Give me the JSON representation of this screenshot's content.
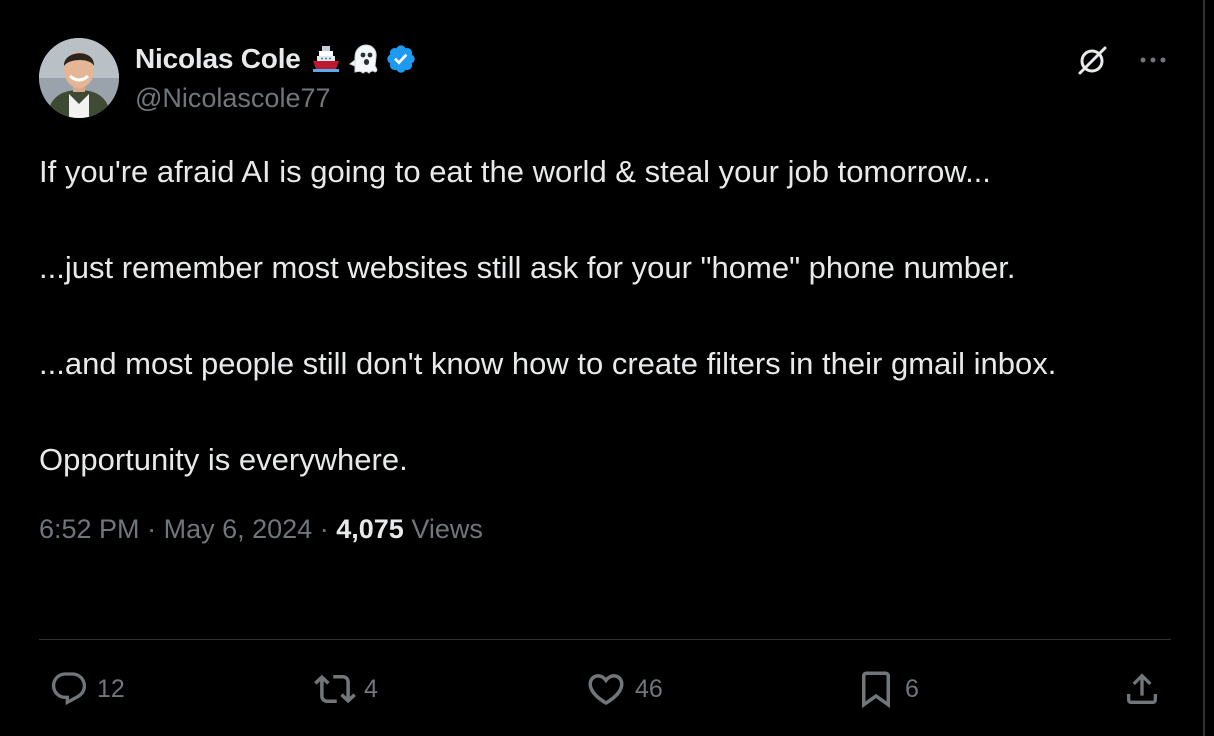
{
  "author": {
    "display_name": "Nicolas Cole",
    "handle": "@Nicolascole77",
    "emojis": [
      "ship-emoji",
      "ghost-emoji"
    ],
    "verified_icon": "verified-badge-icon",
    "verified_color": "#1d9bf0"
  },
  "tweet": {
    "paragraphs": [
      "If you're afraid AI is going to eat the world & steal your job tomorrow...",
      "...just remember most websites still ask for your \"home\" phone number.",
      "...and most people still don't know how to create filters in their gmail inbox.",
      "Opportunity is everywhere."
    ],
    "time": "6:52 PM",
    "date": "May 6, 2024",
    "separator": "·",
    "views_count": "4,075",
    "views_label": "Views"
  },
  "top_actions": {
    "grok_icon": "grok-icon",
    "more_icon": "more-icon"
  },
  "actions": {
    "reply": {
      "icon": "reply-icon",
      "count": "12"
    },
    "repost": {
      "icon": "repost-icon",
      "count": "4"
    },
    "like": {
      "icon": "like-icon",
      "count": "46"
    },
    "bookmark": {
      "icon": "bookmark-icon",
      "count": "6"
    },
    "share": {
      "icon": "share-icon"
    }
  },
  "colors": {
    "background": "#000000",
    "text_primary": "#e7e9ea",
    "text_secondary": "#71767b",
    "divider": "#2f3336",
    "accent_blue": "#1d9bf0"
  }
}
